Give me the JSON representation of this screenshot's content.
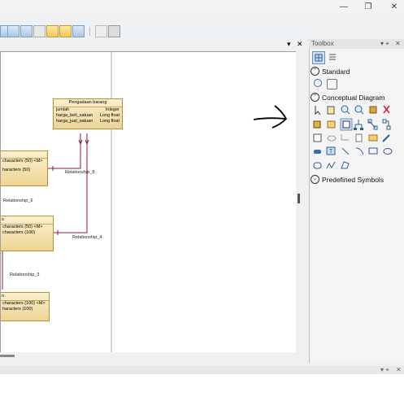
{
  "window": {
    "minimize": "—",
    "maximize": "❐",
    "close": "✕"
  },
  "diagram": {
    "entities": [
      {
        "title": "Pengadaan barang",
        "rows": [
          [
            "jumlah",
            "Integer"
          ],
          [
            "harga_beli_satuan",
            "Long float"
          ],
          [
            "harga_jual_satuan",
            "Long float"
          ]
        ]
      },
      {
        "title": "",
        "rows": [
          [
            "characters (50)  <M>",
            ""
          ],
          [
            "haracters (50)",
            ""
          ]
        ]
      },
      {
        "title": "s",
        "rows": [
          [
            "characters (50)  <M>",
            ""
          ],
          [
            "characters (100)",
            ""
          ]
        ]
      },
      {
        "title": "n",
        "rows": [
          [
            "characters (100)  <M>",
            ""
          ],
          [
            "haracters (100)",
            ""
          ]
        ]
      }
    ],
    "relationships": [
      "Relationship_8",
      "Relationship_6",
      "Relationship_4",
      "Relationship_3"
    ]
  },
  "panel_buttons": {
    "pin": "▾",
    "close": "✕"
  },
  "toolbox": {
    "title": "Toolbox",
    "pin": "▾ ⌖",
    "close": "✕",
    "sections": [
      "Standard",
      "Conceptual Diagram",
      "Predefined Symbols"
    ]
  },
  "bottom_panel": {
    "pin": "▾ ⌖",
    "close": "✕"
  },
  "icons": [
    "minimize-icon",
    "maximize-icon",
    "close-icon",
    "arrow-icon",
    "hand-icon",
    "zoom-in-icon",
    "zoom-out-icon",
    "entity-icon",
    "relationship-icon",
    "note-icon",
    "line-icon",
    "rectangle-icon",
    "ellipse-icon"
  ]
}
